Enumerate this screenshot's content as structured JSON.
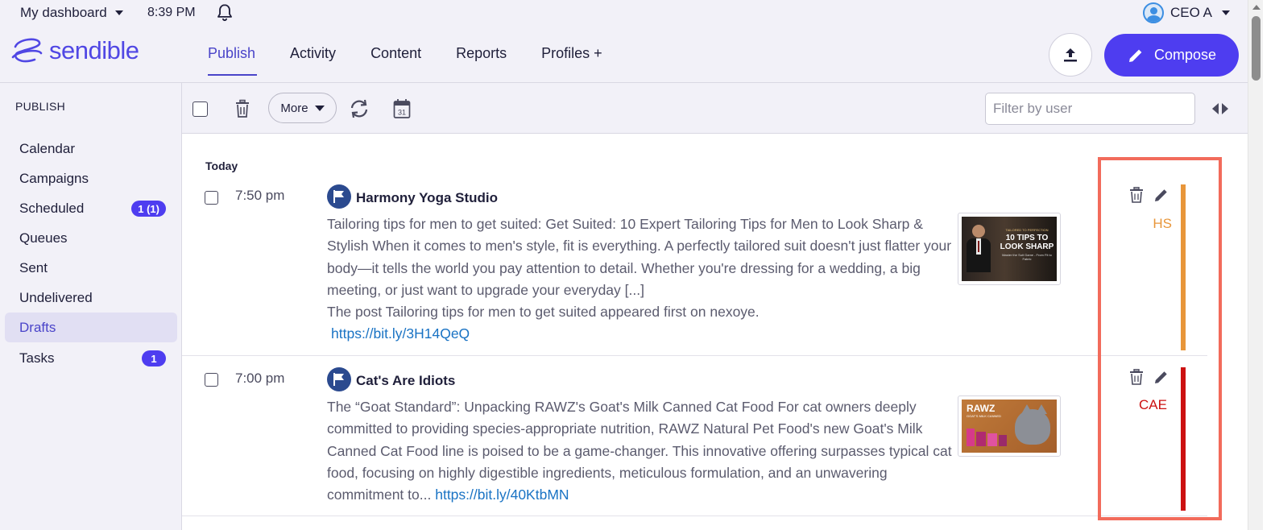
{
  "header": {
    "dashboard_label": "My dashboard",
    "time": "8:39 PM",
    "user_name": "CEO A",
    "logo_text": "sendible",
    "nav": [
      {
        "label": "Publish",
        "active": true
      },
      {
        "label": "Activity"
      },
      {
        "label": "Content"
      },
      {
        "label": "Reports"
      },
      {
        "label": "Profiles +"
      }
    ],
    "compose_label": "Compose"
  },
  "sidebar": {
    "title": "PUBLISH",
    "items": [
      {
        "label": "Calendar"
      },
      {
        "label": "Campaigns"
      },
      {
        "label": "Scheduled",
        "badge": "1 (1)"
      },
      {
        "label": "Queues"
      },
      {
        "label": "Sent"
      },
      {
        "label": "Undelivered"
      },
      {
        "label": "Drafts",
        "active": true
      },
      {
        "label": "Tasks",
        "badge": "1"
      }
    ]
  },
  "toolbar": {
    "more_label": "More",
    "calendar_day": "31",
    "filter_placeholder": "Filter by user"
  },
  "feed": {
    "day_label": "Today",
    "posts": [
      {
        "time": "7:50 pm",
        "profile": "Harmony Yoga Studio",
        "text": "Tailoring tips for men to get suited: Get Suited: 10 Expert Tailoring Tips for Men to Look Sharp & Stylish When it comes to men's style, fit is everything. A perfectly tailored suit doesn't just flatter your body—it tells the world you pay attention to detail. Whether you're dressing for a wedding, a big meeting, or just want to upgrade your everyday [...]",
        "text2": "The post Tailoring tips for men to get suited appeared first on nexoye.",
        "link": "https://bit.ly/3H14QeQ",
        "thumb_caption_small": "TAILORED TO PERFECTION",
        "thumb_caption_big": "10 TIPS TO LOOK SHARP",
        "thumb_caption_sub": "Master the Suit Game - From Fit to Fabric",
        "initials": "HS",
        "color": "#e8963a"
      },
      {
        "time": "7:00 pm",
        "profile": "Cat's Are Idiots",
        "text": "The “Goat Standard”: Unpacking RAWZ's Goat's Milk Canned Cat Food For cat owners deeply committed to providing species-appropriate nutrition, RAWZ Natural Pet Food's new Goat's Milk Canned Cat Food line is poised to be a game-changer. This innovative offering surpasses typical cat food, focusing on highly digestible ingredients, meticulous formulation, and an unwavering commitment to...",
        "link": "https://bit.ly/40KtbMN",
        "thumb_caption_big": "RAWZ",
        "thumb_caption_sub": "GOAT'S MILK CANNED",
        "initials": "CAE",
        "color": "#cc1111"
      }
    ]
  }
}
